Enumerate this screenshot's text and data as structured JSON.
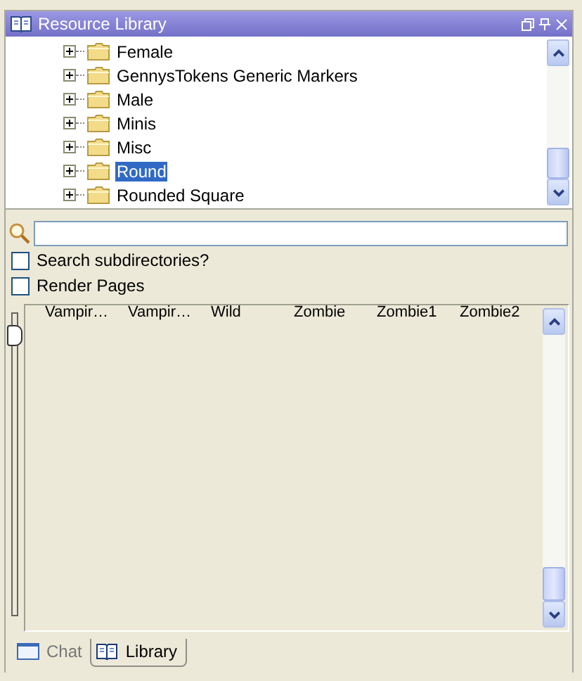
{
  "window": {
    "title": "Resource Library"
  },
  "tree": {
    "items": [
      {
        "label": "Female",
        "expanded": false,
        "selected": false
      },
      {
        "label": "GennysTokens Generic Markers",
        "expanded": false,
        "selected": false
      },
      {
        "label": "Male",
        "expanded": false,
        "selected": false
      },
      {
        "label": "Minis",
        "expanded": false,
        "selected": false
      },
      {
        "label": "Misc",
        "expanded": false,
        "selected": false
      },
      {
        "label": "Round",
        "expanded": false,
        "selected": true
      },
      {
        "label": "Rounded Square",
        "expanded": false,
        "selected": false
      }
    ]
  },
  "options": [
    {
      "label": "Search subdirectories?",
      "checked": false
    },
    {
      "label": "Render Pages",
      "checked": false
    }
  ],
  "zoom_slider": {
    "level": 0.96
  },
  "thumbnails": [
    "Vampir…",
    "Vampir…",
    "Wild",
    "Zombie",
    "Zombie1",
    "Zombie2"
  ],
  "tabs": [
    {
      "label": "Chat",
      "kind": "chat",
      "selected": false
    },
    {
      "label": "Library",
      "kind": "library",
      "selected": true
    }
  ]
}
